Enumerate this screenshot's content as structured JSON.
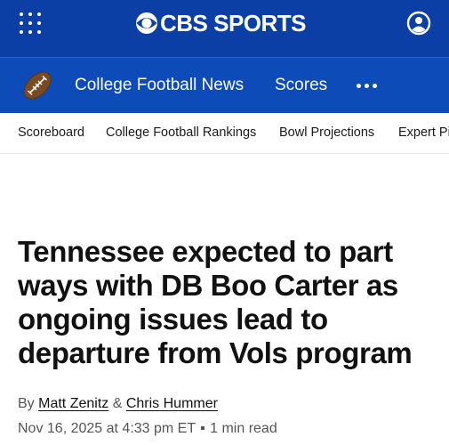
{
  "header": {
    "brand": "CBS SPORTS",
    "menu_icon": "grid-menu-icon",
    "account_icon": "user-account-icon",
    "background": "#0b3fa6"
  },
  "section_nav": {
    "icon": "football-icon",
    "title": "College Football News",
    "scores": "Scores",
    "more_icon": "more-dots-icon",
    "background": "#0d4bb8"
  },
  "sub_nav": {
    "items": [
      {
        "label": "Scoreboard"
      },
      {
        "label": "College Football Rankings"
      },
      {
        "label": "Bowl Projections"
      },
      {
        "label": "Expert Picks"
      }
    ]
  },
  "article": {
    "headline": "Tennessee expected to part ways with DB Boo Carter as ongoing issues lead to departure from Vols program",
    "byline_prefix": "By",
    "author_1": "Matt Zenitz",
    "ampersand": "&",
    "author_2": "Chris Hummer",
    "date": "Nov 16, 2025 at 4:33 pm ET",
    "read_time": "1 min read"
  }
}
